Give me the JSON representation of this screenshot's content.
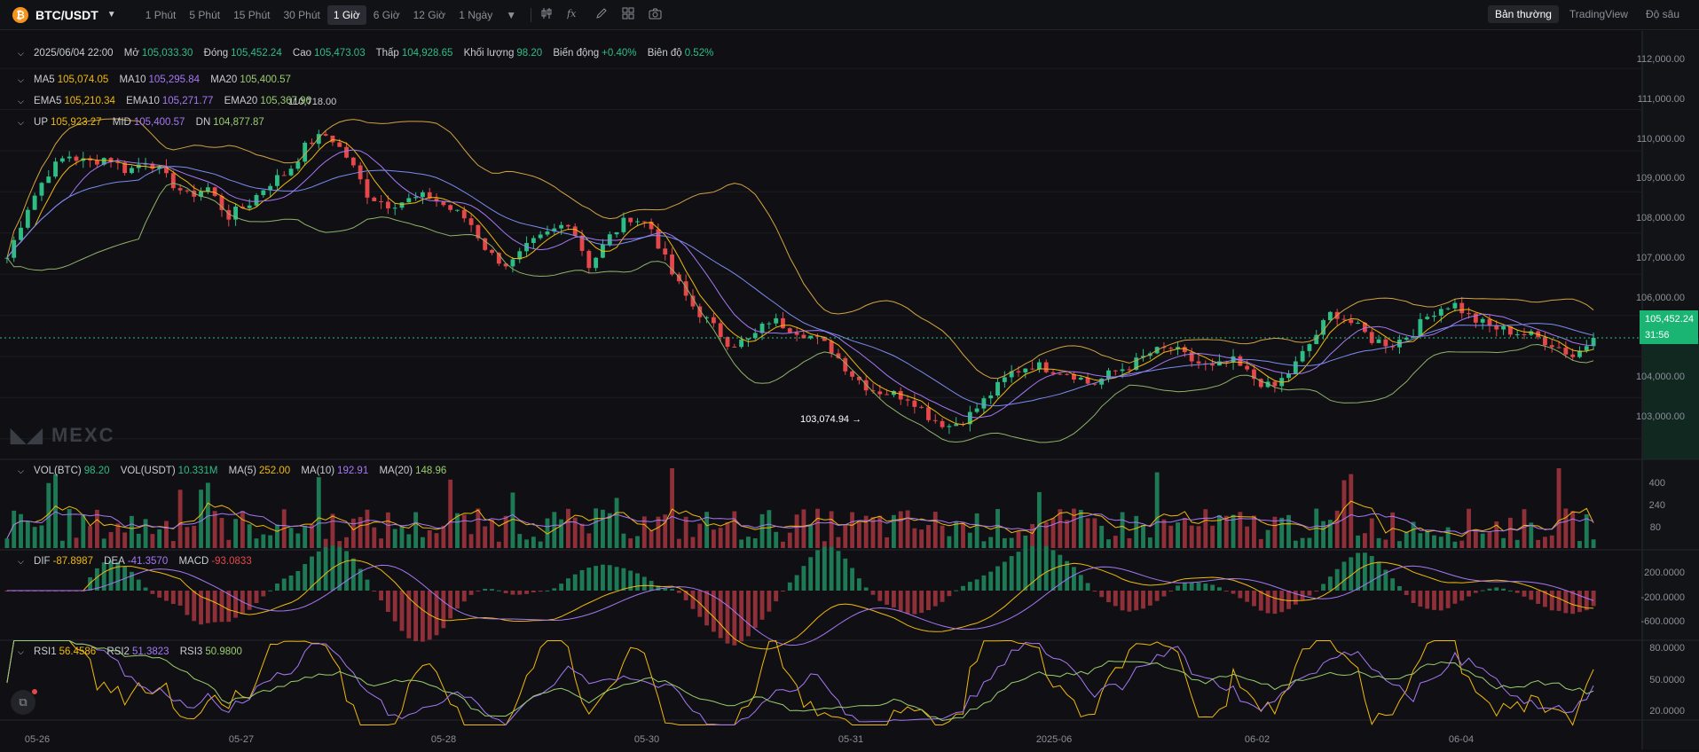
{
  "header": {
    "coin_glyph": "₿",
    "symbol": "BTC/USDT",
    "symbol_caret": "▼",
    "timeframes": [
      "1 Phút",
      "5 Phút",
      "15 Phút",
      "30 Phút",
      "1 Giờ",
      "6 Giờ",
      "12 Giờ",
      "1 Ngày"
    ],
    "active_timeframe": "1 Giờ",
    "timeframe_caret": "▼",
    "tools": [
      "candle-settings-icon",
      "indicator-fx-icon",
      "draw-pen-icon",
      "layout-grid-icon",
      "camera-icon"
    ],
    "view_modes": [
      "Bản thường",
      "TradingView",
      "Độ sâu"
    ],
    "active_view": "Bản thường"
  },
  "ohlc": {
    "datetime": "2025/06/04 22:00",
    "open_label": "Mở",
    "open": "105,033.30",
    "close_label": "Đóng",
    "close": "105,452.24",
    "high_label": "Cao",
    "high": "105,473.03",
    "low_label": "Thấp",
    "low": "104,928.65",
    "volume_label": "Khối lượng",
    "volume": "98.20",
    "change_label": "Biến động",
    "change": "+0.40%",
    "amplitude_label": "Biên độ",
    "amplitude": "0.52%"
  },
  "ma": {
    "ma5_label": "MA5",
    "ma5": "105,074.05",
    "ma10_label": "MA10",
    "ma10": "105,295.84",
    "ma20_label": "MA20",
    "ma20": "105,400.57"
  },
  "ema": {
    "ema5_label": "EMA5",
    "ema5": "105,210.34",
    "ema10_label": "EMA10",
    "ema10": "105,271.77",
    "ema20_label": "EMA20",
    "ema20": "105,367.96"
  },
  "boll": {
    "up_label": "UP",
    "up": "105,923.27",
    "mid_label": "MID",
    "mid": "105,400.57",
    "dn_label": "DN",
    "dn": "104,877.87"
  },
  "vol": {
    "btc_label": "VOL(BTC)",
    "btc": "98.20",
    "usdt_label": "VOL(USDT)",
    "usdt": "10.331M",
    "ma5_label": "MA(5)",
    "ma5": "252.00",
    "ma10_label": "MA(10)",
    "ma10": "192.91",
    "ma20_label": "MA(20)",
    "ma20": "148.96"
  },
  "macd": {
    "dif_label": "DIF",
    "dif": "-87.8987",
    "dea_label": "DEA",
    "dea": "-41.3570",
    "macd_label": "MACD",
    "macd": "-93.0833"
  },
  "rsi": {
    "rsi1_label": "RSI1",
    "rsi1": "56.4586",
    "rsi2_label": "RSI2",
    "rsi2": "51.3823",
    "rsi3_label": "RSI3",
    "rsi3": "50.9800"
  },
  "price_axis": [
    "112,000.00",
    "111,000.00",
    "110,000.00",
    "109,000.00",
    "108,000.00",
    "107,000.00",
    "106,000.00",
    "104,000.00",
    "103,000.00"
  ],
  "vol_axis": [
    "400",
    "240",
    "80"
  ],
  "macd_axis": [
    "200.0000",
    "-200.0000",
    "-600.0000"
  ],
  "rsi_axis": [
    "80.0000",
    "50.0000",
    "20.0000"
  ],
  "dates": [
    "05-26",
    "05-27",
    "05-28",
    "05-30",
    "05-31",
    "2025-06",
    "06-02",
    "06-04"
  ],
  "last_price": "105,452.24",
  "countdown": "31:56",
  "low_marker": "103,074.94",
  "high_marker": "110,718.00",
  "watermark": "MEXC",
  "colors": {
    "up": "#2ebd85",
    "down": "#e5474a",
    "ma5": "#f0b90b",
    "ma10": "#a578f5",
    "ma20": "#9acd6e",
    "background": "#101014"
  },
  "chart_data": {
    "type": "candlestick",
    "timeframe": "1 Giờ",
    "y_range": [
      102500,
      112800
    ],
    "close_path": [
      107400,
      108600,
      109450,
      109900,
      109700,
      109850,
      109500,
      109800,
      109300,
      108900,
      109100,
      108400,
      108700,
      109200,
      109500,
      110200,
      110400,
      109800,
      108900,
      108700,
      108800,
      108900,
      108600,
      108300,
      107500,
      107200,
      107700,
      108000,
      108300,
      107200,
      107900,
      108400,
      108200,
      107100,
      106300,
      105800,
      105300,
      105400,
      105900,
      105700,
      105500,
      105200,
      104600,
      104200,
      104100,
      104000,
      103500,
      103300,
      103600,
      104100,
      104600,
      104800,
      104700,
      104600,
      104300,
      104600,
      104800,
      105100,
      105200,
      104900,
      104700,
      104900,
      104500,
      104200,
      104700,
      105400,
      106100,
      105800,
      105400,
      105300,
      105600,
      106100,
      106300,
      105900,
      105700,
      105600,
      105500,
      105300,
      105000,
      105452
    ],
    "close_last": 105452.24,
    "bollinger_last": {
      "up": 105923.27,
      "mid": 105400.57,
      "dn": 104877.87
    }
  }
}
